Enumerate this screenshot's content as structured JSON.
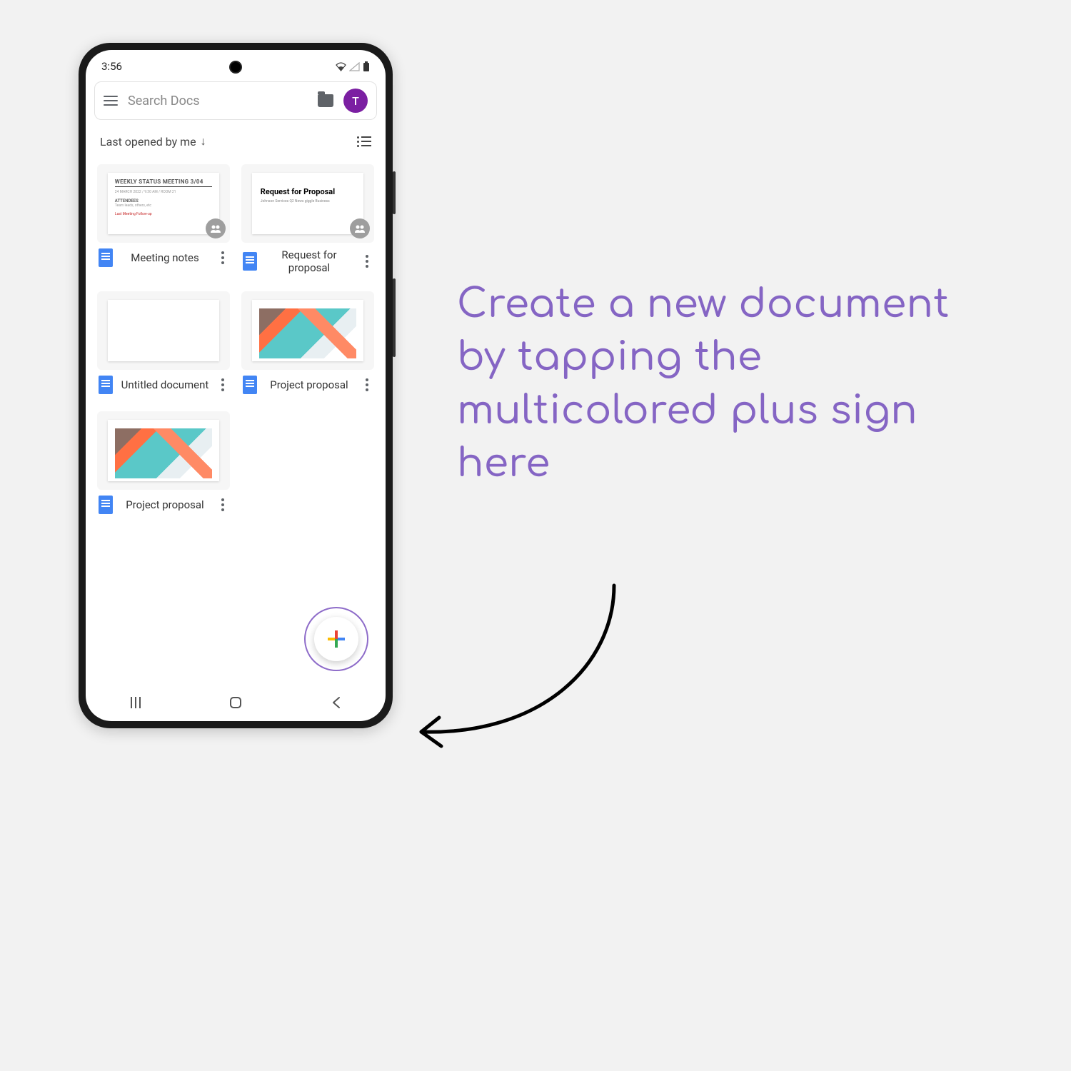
{
  "status": {
    "time": "3:56"
  },
  "search": {
    "placeholder": "Search Docs",
    "avatar_initial": "T"
  },
  "sort": {
    "label": "Last opened by me",
    "arrow": "↓"
  },
  "docs": [
    {
      "title": "Meeting notes",
      "shared": true,
      "thumb": "meeting"
    },
    {
      "title": "Request for proposal",
      "shared": true,
      "thumb": "proposal"
    },
    {
      "title": "Untitled document",
      "shared": false,
      "thumb": "blank"
    },
    {
      "title": "Project proposal",
      "shared": false,
      "thumb": "geo"
    },
    {
      "title": "Project proposal",
      "shared": false,
      "thumb": "geo"
    }
  ],
  "thumb_text": {
    "meeting_header": "WEEKLY STATUS MEETING 3/04",
    "proposal_title": "Request for Proposal",
    "proposal_sub": "Johnson Services Q2 News giggle Business"
  },
  "callout": "Create a new document by tapping the multicolored plus sign here"
}
